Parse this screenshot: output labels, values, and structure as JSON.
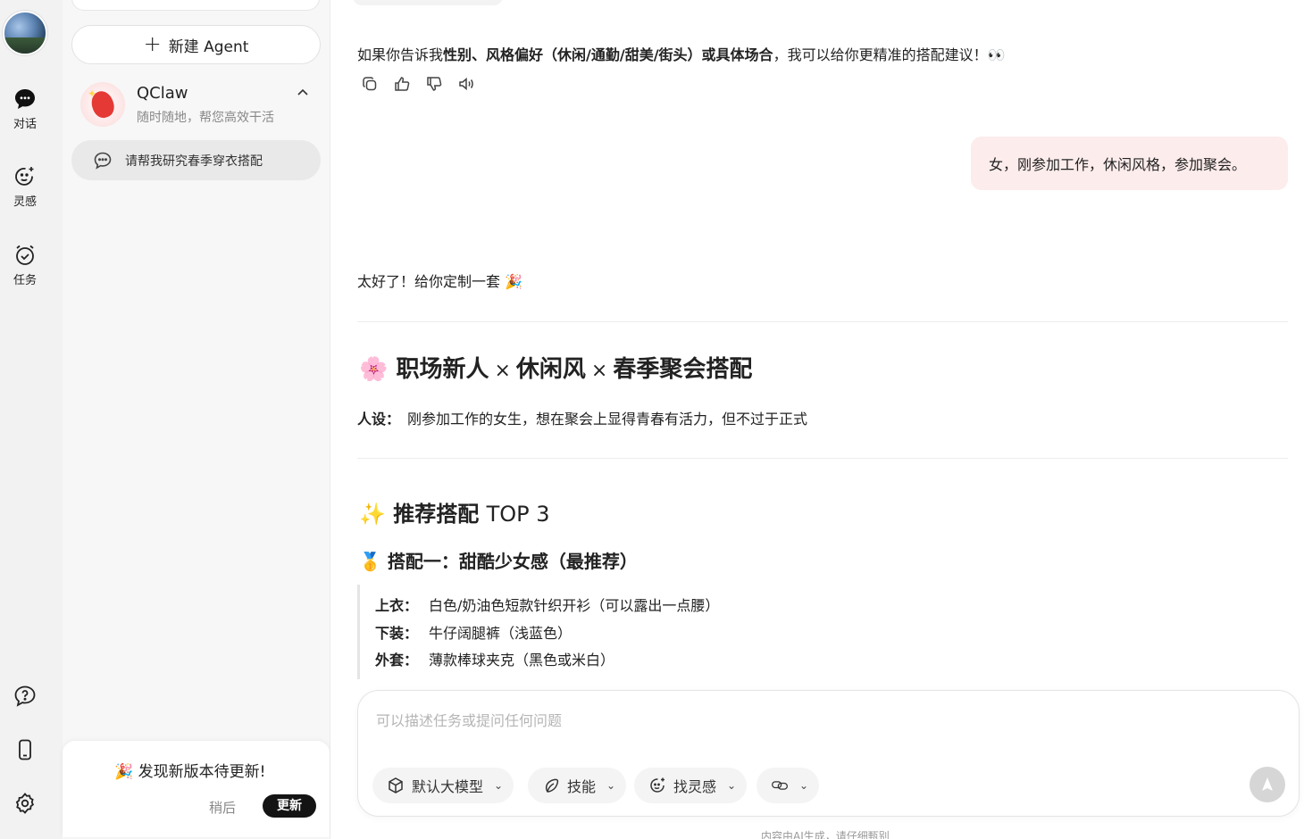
{
  "rail": {
    "items": [
      {
        "label": "对话",
        "icon": "chat-bubble-icon"
      },
      {
        "label": "灵感",
        "icon": "sparkle-face-icon"
      },
      {
        "label": "任务",
        "icon": "alarm-clock-icon"
      }
    ],
    "bottom_icons": [
      "help-icon",
      "phone-icon",
      "settings-icon"
    ]
  },
  "sidebar": {
    "new_agent_label": "新建 Agent",
    "agent": {
      "name": "QClaw",
      "description": "随时随地，帮您高效干活"
    },
    "conversation": {
      "title": "请帮我研究春季穿衣搭配"
    },
    "update": {
      "title": "🎉 发现新版本待更新!",
      "later_label": "稍后",
      "update_label": "更新"
    }
  },
  "chat": {
    "assistant_prev": {
      "prefix": "如果你告诉我",
      "bold": "性别、风格偏好（休闲/通勤/甜美/街头）或具体场合",
      "suffix": "，我可以给你更精准的搭配建议！👀"
    },
    "actions": [
      "copy-icon",
      "thumbs-up-icon",
      "thumbs-down-icon",
      "speaker-icon"
    ],
    "user_message": "女，刚参加工作，休闲风格，参加聚会。",
    "reply_intro": "太好了！给你定制一套 🎉",
    "heading": {
      "emoji": "🌸",
      "part1": "职场新人",
      "sep": "×",
      "part2": "休闲风",
      "part3": "春季聚会搭配"
    },
    "persona": {
      "label": "人设：",
      "text": "刚参加工作的女生，想在聚会上显得青春有活力，但不过于正式"
    },
    "section_title": {
      "emoji": "✨",
      "text": "推荐搭配",
      "en": "TOP 3"
    },
    "outfit_title": {
      "emoji": "🥇",
      "text": "搭配一：甜酷少女感（最推荐）"
    },
    "outfit_items": [
      {
        "label": "上衣：",
        "value": "白色/奶油色短款针织开衫（可以露出一点腰）"
      },
      {
        "label": "下装：",
        "value": "牛仔阔腿裤（浅蓝色）"
      },
      {
        "label": "外套：",
        "value": "薄款棒球夹克（黑色或米白）"
      }
    ]
  },
  "composer": {
    "placeholder": "可以描述任务或提问任何问题",
    "chips": [
      {
        "label": "默认大模型",
        "icon": "cube-icon"
      },
      {
        "label": "技能",
        "icon": "leaf-icon"
      },
      {
        "label": "找灵感",
        "icon": "sparkle-face-icon"
      },
      {
        "label": "",
        "icon": "link-icon"
      }
    ],
    "footnote": "内容由AI生成，请仔细甄别"
  },
  "colors": {
    "user_bubble": "#fdecec",
    "update_button": "#141414",
    "rail_bg": "#f2f2f2"
  }
}
